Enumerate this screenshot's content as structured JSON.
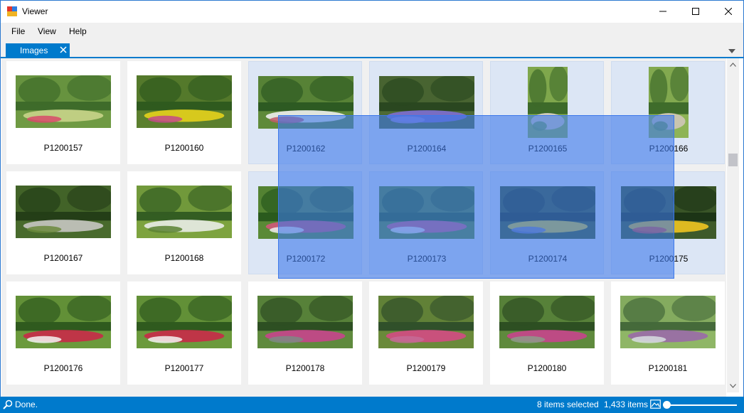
{
  "window": {
    "title": "Viewer"
  },
  "menu": [
    "File",
    "View",
    "Help"
  ],
  "tab": {
    "label": "Images"
  },
  "tiles": [
    {
      "name": "P1200157",
      "selected": false
    },
    {
      "name": "P1200160",
      "selected": false
    },
    {
      "name": "P1200162",
      "selected": true
    },
    {
      "name": "P1200164",
      "selected": true
    },
    {
      "name": "P1200165",
      "selected": true
    },
    {
      "name": "P1200166",
      "selected": true
    },
    {
      "name": "P1200167",
      "selected": false
    },
    {
      "name": "P1200168",
      "selected": false
    },
    {
      "name": "P1200172",
      "selected": true
    },
    {
      "name": "P1200173",
      "selected": true
    },
    {
      "name": "P1200174",
      "selected": true
    },
    {
      "name": "P1200175",
      "selected": true
    },
    {
      "name": "P1200176",
      "selected": false
    },
    {
      "name": "P1200177",
      "selected": false
    },
    {
      "name": "P1200178",
      "selected": false
    },
    {
      "name": "P1200179",
      "selected": false
    },
    {
      "name": "P1200180",
      "selected": false
    },
    {
      "name": "P1200181",
      "selected": false
    }
  ],
  "status": {
    "message": "Done.",
    "selected_count": "8 items selected",
    "total_count": "1,433 items",
    "icons": {
      "left": "search-icon",
      "zoom": "image-icon"
    }
  },
  "colors": {
    "accent": "#007acc",
    "selection_tile": "#dce6f5",
    "lasso": "#3c78ea"
  }
}
